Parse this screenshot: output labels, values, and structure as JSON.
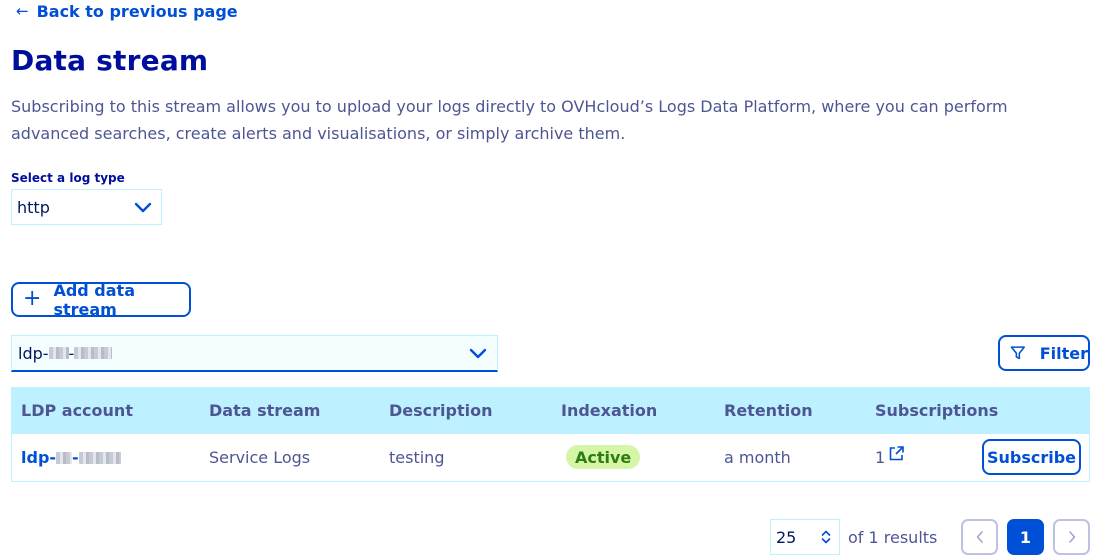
{
  "nav": {
    "back_label": "Back to previous page"
  },
  "header": {
    "title": "Data stream",
    "description": "Subscribing to this stream allows you to upload your logs directly to OVHcloud’s Logs Data Platform, where you can perform advanced searches, create alerts and visualisations, or simply archive them."
  },
  "log_type": {
    "label": "Select a log type",
    "value": "http"
  },
  "actions": {
    "add_label": "Add data stream",
    "filter_label": "Filter"
  },
  "account_select": {
    "value_prefix": "ldp-"
  },
  "table": {
    "columns": [
      "LDP account",
      "Data stream",
      "Description",
      "Indexation",
      "Retention",
      "Subscriptions"
    ],
    "rows": [
      {
        "account_prefix": "ldp-",
        "data_stream": "Service Logs",
        "description": "testing",
        "indexation": "Active",
        "retention": "a month",
        "subscriptions": "1",
        "action_label": "Subscribe"
      }
    ]
  },
  "pagination": {
    "page_size": "25",
    "results_text": "of 1 results",
    "current_page": "1"
  },
  "colors": {
    "primary": "#0050d7",
    "title": "#000e9c",
    "text": "#4d5693",
    "header_bg": "#bef1ff",
    "badge_bg": "#d5f5a7"
  },
  "icons": {
    "back": "arrow-left-icon",
    "add": "plus-icon",
    "filter": "funnel-icon",
    "chevron": "chevron-down-icon",
    "external": "external-link-icon"
  }
}
